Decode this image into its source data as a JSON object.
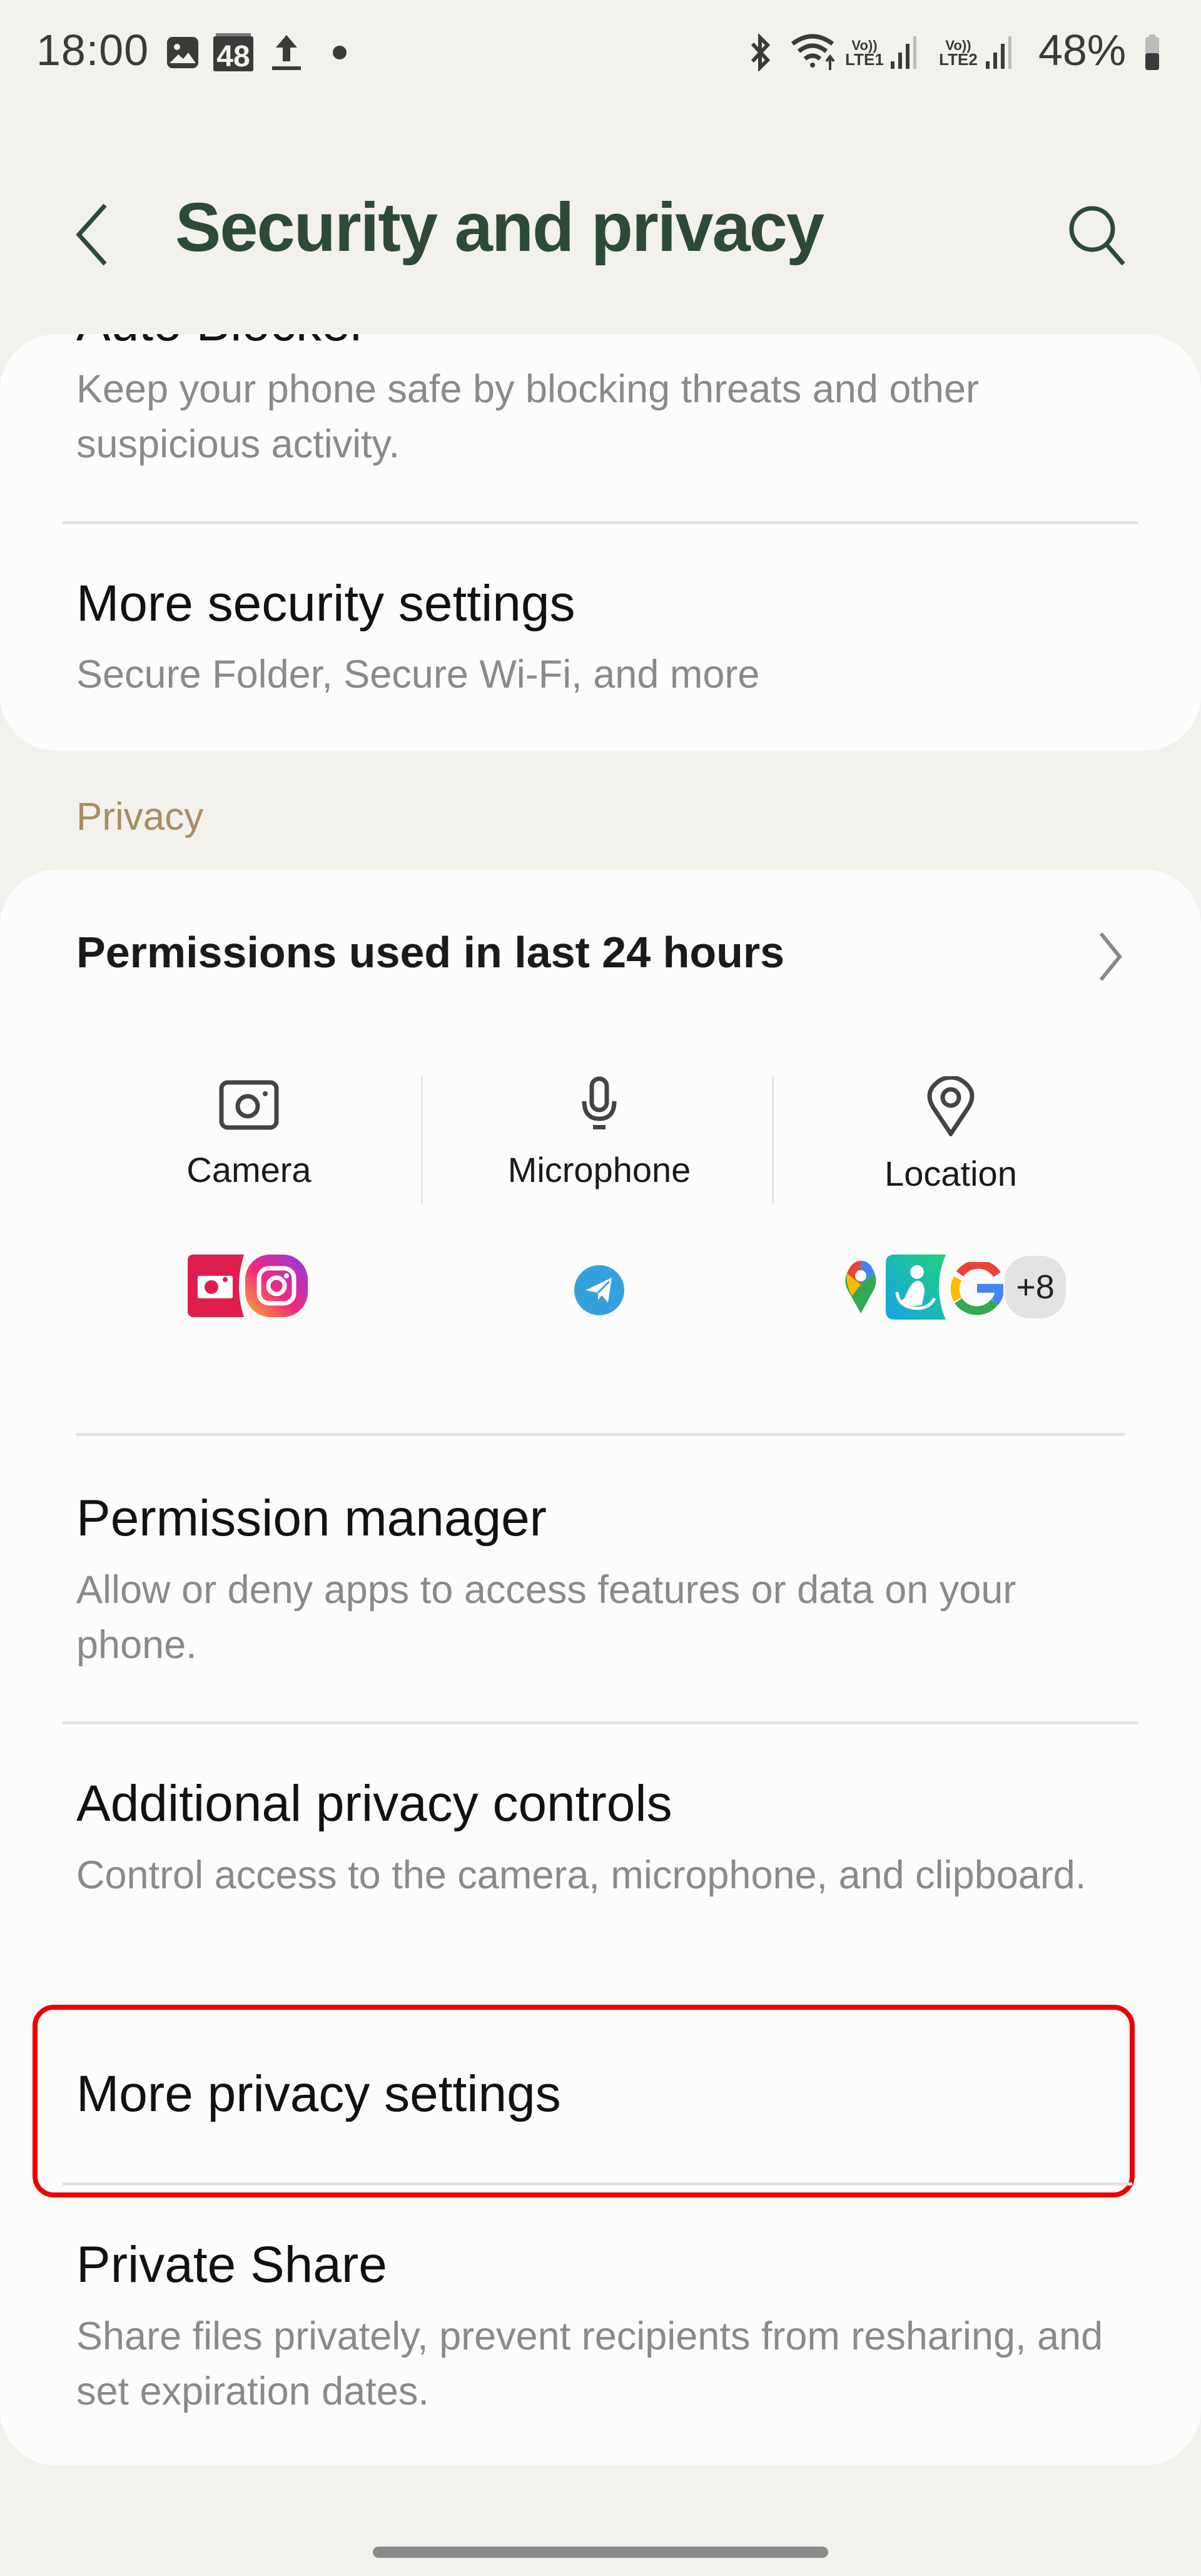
{
  "status_bar": {
    "time": "18:00",
    "left_icons": [
      "gallery-icon",
      "calendar-48-icon",
      "upload-icon",
      "dot-icon"
    ],
    "calendar_badge": "48",
    "right_icons": [
      "bluetooth-icon",
      "wifi-icon",
      "volte-lte1-icon",
      "signal-1-icon",
      "volte-lte2-icon",
      "signal-2-icon",
      "battery-icon"
    ],
    "volte_label": "Vo))",
    "lte1_label": "LTE1",
    "lte2_label": "LTE2",
    "battery_percent": "48%",
    "battery_level": 0.48
  },
  "header": {
    "title": "Security and privacy",
    "back_icon": "chevron-left-icon",
    "search_icon": "search-icon"
  },
  "security_card": {
    "items": [
      {
        "title": "Auto Blocker",
        "subtitle": "Keep your phone safe by blocking threats and other suspicious activity."
      },
      {
        "title": "More security settings",
        "subtitle": "Secure Folder, Secure Wi-Fi, and more"
      }
    ]
  },
  "privacy_section": {
    "header": "Privacy",
    "permissions_used": {
      "title": "Permissions used in last 24 hours",
      "columns": [
        {
          "label": "Camera",
          "icon": "camera-icon",
          "apps": [
            "samsung-camera-app-icon",
            "instagram-app-icon"
          ]
        },
        {
          "label": "Microphone",
          "icon": "microphone-icon",
          "apps": [
            "telegram-app-icon"
          ]
        },
        {
          "label": "Location",
          "icon": "location-pin-icon",
          "apps": [
            "google-maps-app-icon",
            "samsung-health-app-icon",
            "google-app-icon"
          ],
          "more_count": "+8"
        }
      ]
    },
    "items": [
      {
        "title": "Permission manager",
        "subtitle": "Allow or deny apps to access features or data on your phone."
      },
      {
        "title": "Additional privacy controls",
        "subtitle": "Control access to the camera, microphone, and clipboard."
      },
      {
        "title": "More privacy settings",
        "highlighted": true
      },
      {
        "title": "Private Share",
        "subtitle": "Share files privately, prevent recipients from resharing, and set expiration dates."
      }
    ]
  },
  "colors": {
    "background": "#f2f1ec",
    "card": "#fcfcfc",
    "title_green": "#2d4a38",
    "section_header": "#a88c64",
    "subtitle_gray": "#8a8a8a",
    "highlight_red": "#ee0000"
  }
}
